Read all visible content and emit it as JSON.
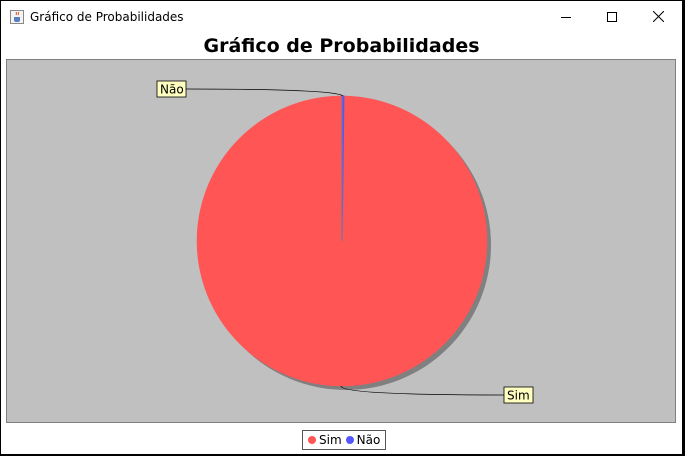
{
  "window": {
    "title": "Gráfico de Probabilidades",
    "app_icon": "java-cup-icon",
    "controls": [
      "minimize-icon",
      "maximize-icon",
      "close-icon"
    ]
  },
  "chart_data": {
    "type": "pie",
    "title": "Gráfico de Probabilidades",
    "labels": [
      "Sim",
      "Não"
    ],
    "values": [
      99.8,
      0.2
    ],
    "colors": [
      "#ff5555",
      "#5555ff"
    ],
    "plot_background": "#c0c0c0",
    "legend_position": "bottom",
    "legend": [
      {
        "label": "Sim",
        "color": "#ff5555"
      },
      {
        "label": "Não",
        "color": "#5555ff"
      }
    ]
  }
}
